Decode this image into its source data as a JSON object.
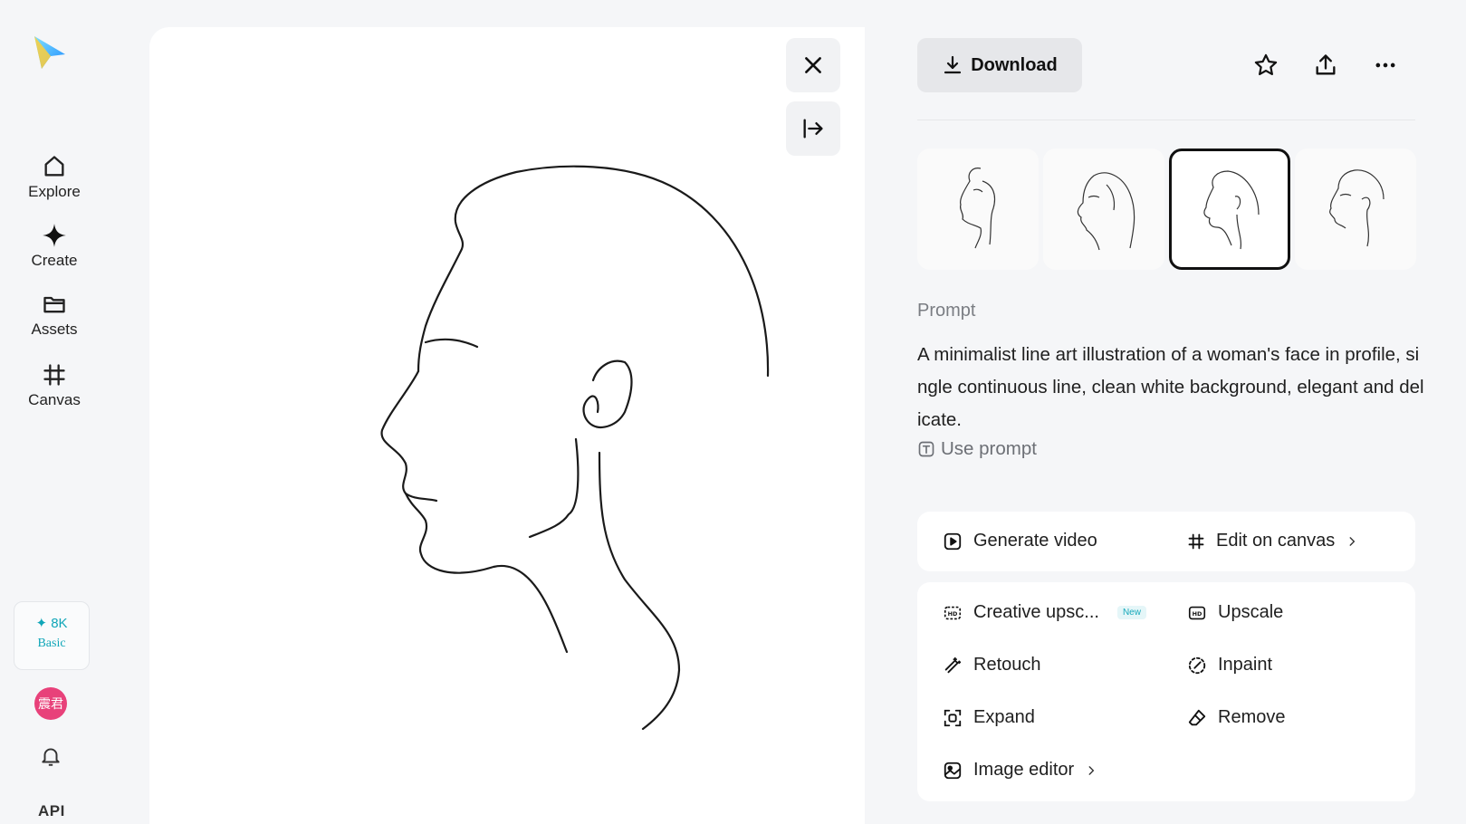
{
  "nav": {
    "items": [
      {
        "label": "Explore",
        "icon": "home-icon"
      },
      {
        "label": "Create",
        "icon": "sparkle-icon"
      },
      {
        "label": "Assets",
        "icon": "folder-icon"
      },
      {
        "label": "Canvas",
        "icon": "canvas-icon"
      }
    ],
    "credits": "8K",
    "plan": "Basic",
    "avatar_text": "震君",
    "api_label": "API"
  },
  "toolbar": {
    "download_label": "Download",
    "icons": [
      "star-icon",
      "share-icon",
      "more-icon"
    ]
  },
  "thumbnails": {
    "count": 4,
    "selected_index": 2
  },
  "prompt": {
    "heading": "Prompt",
    "text": "A minimalist line art illustration of a woman's face in profile, single continuous line, clean white background, elegant and delicate.",
    "use_label": "Use prompt"
  },
  "actions": {
    "generate_video": "Generate video",
    "edit_on_canvas": "Edit on canvas",
    "creative_upscale": "Creative upsc...",
    "new_badge": "New",
    "upscale": "Upscale",
    "retouch": "Retouch",
    "inpaint": "Inpaint",
    "expand": "Expand",
    "remove": "Remove",
    "image_editor": "Image editor"
  },
  "colors": {
    "accent": "#10a6b8",
    "avatar": "#e8417a"
  }
}
